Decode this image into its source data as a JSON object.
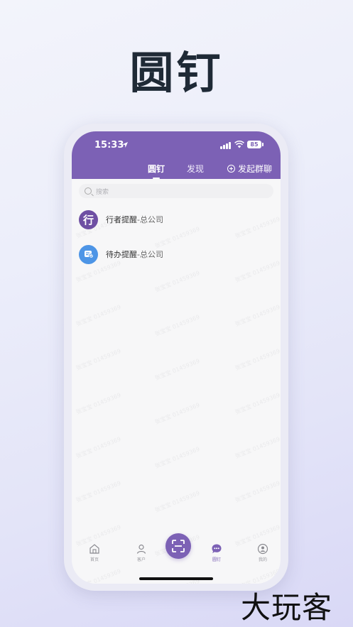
{
  "hero": {
    "title": "圆钉"
  },
  "status_bar": {
    "time": "15:33",
    "battery": "85"
  },
  "header": {
    "tabs": [
      {
        "label": "圆钉",
        "active": true
      },
      {
        "label": "发现",
        "active": false
      }
    ],
    "group_chat_label": "发起群聊",
    "accent_color": "#7c61b5"
  },
  "search": {
    "placeholder": "搜索"
  },
  "list": [
    {
      "avatar_text": "行",
      "title": "行者提醒",
      "subtitle": "-总公司",
      "icon": "avatar-xingzhe"
    },
    {
      "avatar_text": "",
      "title": "待办提醒",
      "subtitle": "-总公司",
      "icon": "todo-icon"
    }
  ],
  "watermark": {
    "text": "张宝宝 01459369"
  },
  "bottom_nav": {
    "items": [
      {
        "label": "首页",
        "icon": "home-icon"
      },
      {
        "label": "客户",
        "icon": "customer-icon"
      },
      {
        "label": "圆钉",
        "icon": "chat-bubble-icon",
        "active": true
      },
      {
        "label": "我的",
        "icon": "user-icon"
      }
    ],
    "scan_icon": "scan-icon"
  },
  "brand": {
    "text": "大玩客"
  }
}
